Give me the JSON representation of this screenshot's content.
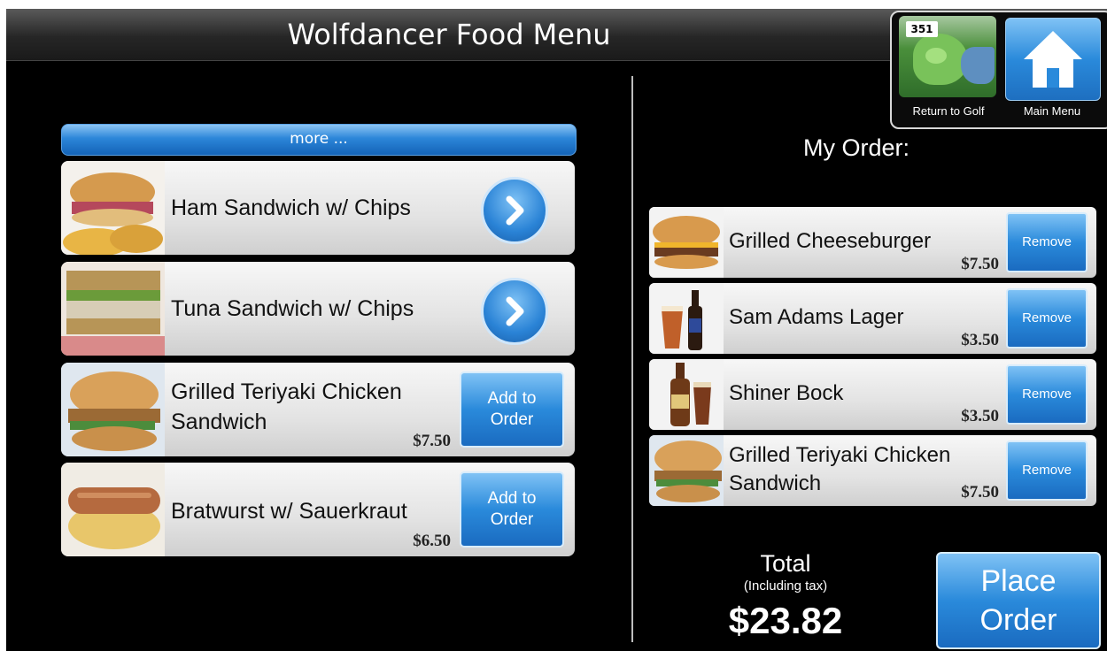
{
  "header": {
    "title": "Wolfdancer Food Menu"
  },
  "nav": {
    "golf_label": "Return to Golf",
    "golf_hole": "351",
    "home_label": "Main Menu"
  },
  "menu": {
    "more_label": "more ...",
    "add_label_line1": "Add to",
    "add_label_line2": "Order",
    "items": [
      {
        "name": "Ham Sandwich w/ Chips",
        "price": "",
        "action": "arrow"
      },
      {
        "name": "Tuna Sandwich w/ Chips",
        "price": "",
        "action": "arrow"
      },
      {
        "name_line1": "Grilled Teriyaki Chicken",
        "name_line2": "Sandwich",
        "price": "$7.50",
        "action": "add"
      },
      {
        "name": "Bratwurst w/ Sauerkraut",
        "price": "$6.50",
        "action": "add"
      }
    ]
  },
  "order": {
    "title": "My Order:",
    "remove_label": "Remove",
    "items": [
      {
        "name": "Grilled Cheeseburger",
        "price": "$7.50"
      },
      {
        "name": "Sam Adams Lager",
        "price": "$3.50"
      },
      {
        "name": "Shiner Bock",
        "price": "$3.50"
      },
      {
        "name_line1": "Grilled Teriyaki Chicken",
        "name_line2": "Sandwich",
        "price": "$7.50"
      }
    ],
    "total_label": "Total",
    "total_note": "(Including tax)",
    "total_amount": "$23.82",
    "place_line1": "Place",
    "place_line2": "Order"
  },
  "colors": {
    "accent": "#2a8adb",
    "background": "#000000",
    "panel": "#e3e3e3"
  }
}
